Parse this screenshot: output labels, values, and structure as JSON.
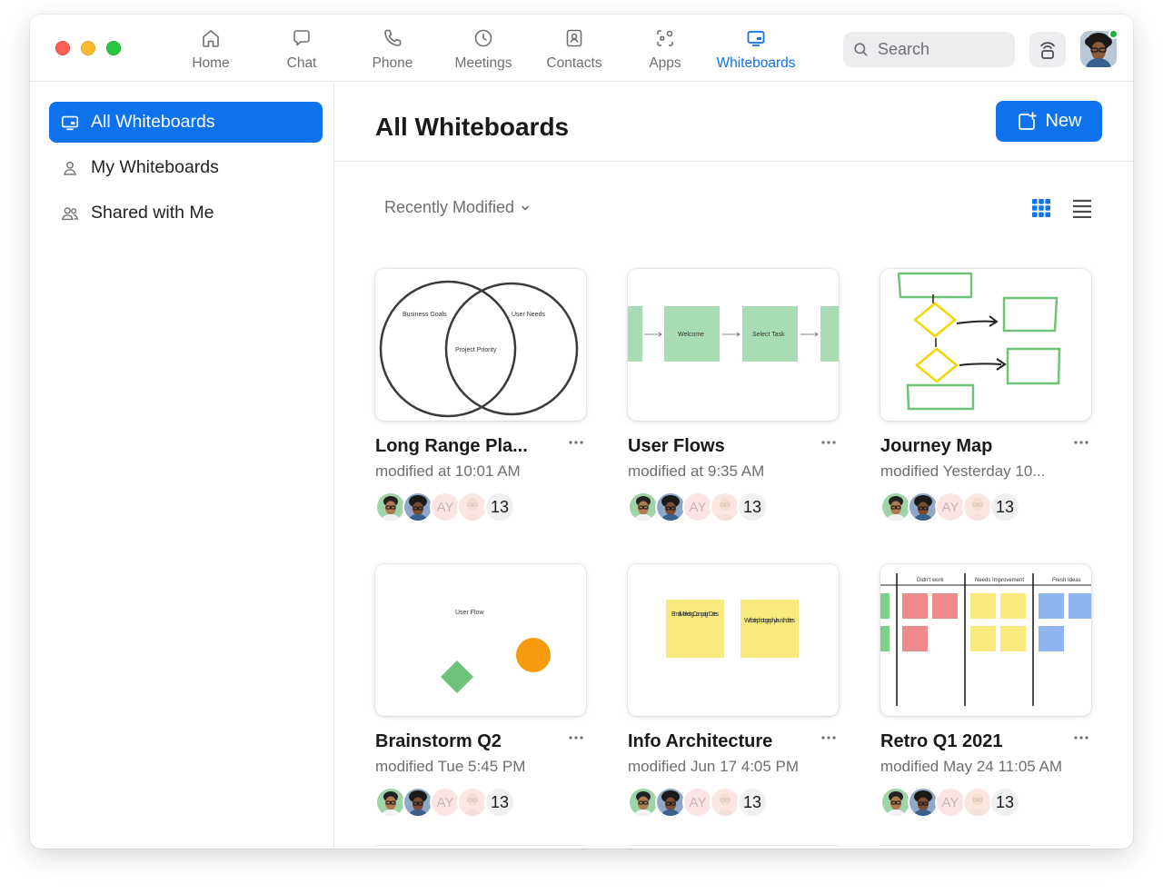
{
  "nav": {
    "tabs": [
      {
        "label": "Home",
        "icon": "home-icon"
      },
      {
        "label": "Chat",
        "icon": "chat-icon"
      },
      {
        "label": "Phone",
        "icon": "phone-icon"
      },
      {
        "label": "Meetings",
        "icon": "clock-icon"
      },
      {
        "label": "Contacts",
        "icon": "contacts-icon"
      },
      {
        "label": "Apps",
        "icon": "apps-icon"
      },
      {
        "label": "Whiteboards",
        "icon": "whiteboard-icon",
        "active": true
      }
    ],
    "search_placeholder": "Search"
  },
  "sidebar": {
    "items": [
      {
        "label": "All Whiteboards",
        "icon": "whiteboard-icon",
        "active": true
      },
      {
        "label": "My Whiteboards",
        "icon": "person-icon"
      },
      {
        "label": "Shared with Me",
        "icon": "people-icon"
      }
    ]
  },
  "main": {
    "title": "All Whiteboards",
    "new_label": "New",
    "sort_label": "Recently Modified",
    "cards": [
      {
        "title": "Long Range Pla...",
        "modified": "modified at 10:01 AM",
        "thumb": {
          "labels": [
            "Business Goals",
            "User Needs",
            "Project Priority"
          ]
        }
      },
      {
        "title": "User Flows",
        "modified": "modified at 9:35 AM",
        "thumb": {
          "labels": [
            "Welcome",
            "Select Task"
          ]
        }
      },
      {
        "title": "Journey Map",
        "modified": "modified Yesterday 10...",
        "thumb": {
          "labels": []
        }
      },
      {
        "title": "Brainstorm Q2",
        "modified": "modified Tue 5:45 PM",
        "thumb": {
          "labels": [
            "User Flow"
          ]
        }
      },
      {
        "title": "Info Architecture",
        "modified": "modified Jun 17 4:05 PM",
        "thumb": {
          "labels": [
            "Email Marketing Campaign Dates",
            "Website photography launch dates"
          ]
        }
      },
      {
        "title": "Retro Q1 2021",
        "modified": "modified May 24 11:05 AM",
        "thumb": {
          "labels": [
            "Didn't work",
            "Needs Improvement",
            "Fresh Ideas"
          ]
        }
      }
    ],
    "collaborators": {
      "initials": "AY",
      "count": "13"
    }
  },
  "colors": {
    "accent": "#0e72ed",
    "online": "#1ab23a"
  }
}
